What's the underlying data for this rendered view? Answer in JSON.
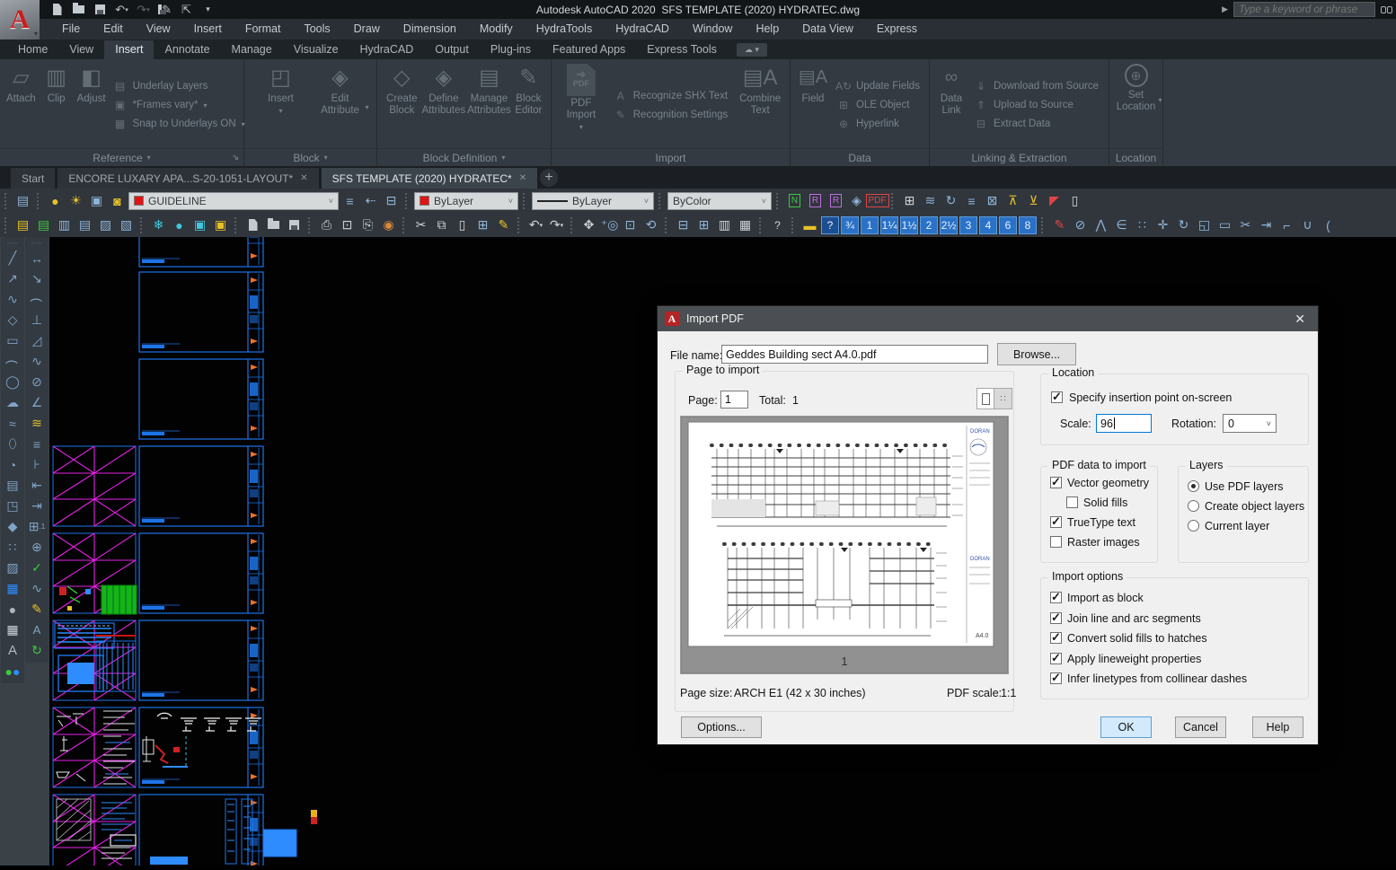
{
  "titlebar": {
    "app_title": "Autodesk AutoCAD 2020",
    "doc_title": "SFS TEMPLATE (2020) HYDRATEC.dwg",
    "search_placeholder": "Type a keyword or phrase"
  },
  "menubar": {
    "items": [
      "File",
      "Edit",
      "View",
      "Insert",
      "Format",
      "Tools",
      "Draw",
      "Dimension",
      "Modify",
      "HydraTools",
      "HydraCAD",
      "Window",
      "Help",
      "Data View",
      "Express"
    ]
  },
  "ribbon": {
    "tabs": [
      "Home",
      "View",
      "Insert",
      "Annotate",
      "Manage",
      "Visualize",
      "HydraCAD",
      "Output",
      "Plug-ins",
      "Featured Apps",
      "Express Tools"
    ],
    "active_tab": "Insert",
    "panels": [
      {
        "label": "Reference",
        "big": [
          "Attach",
          "Clip",
          "Adjust"
        ],
        "rows": [
          "Underlay Layers",
          "*Frames vary*",
          "Snap to Underlays ON"
        ]
      },
      {
        "label": "Block",
        "big": [
          "Insert",
          "Edit Attribute"
        ]
      },
      {
        "label": "Block Definition",
        "big": [
          "Create Block",
          "Define Attributes",
          "Manage Attributes",
          "Block Editor"
        ]
      },
      {
        "label": "Import",
        "big": [
          "PDF Import",
          "Combine Text"
        ],
        "rows": [
          "Recognize SHX Text",
          "Recognition Settings"
        ]
      },
      {
        "label": "Data",
        "big": [
          "Field"
        ],
        "rows": [
          "Update Fields",
          "OLE Object",
          "Hyperlink"
        ]
      },
      {
        "label": "Linking & Extraction",
        "big": [
          "Data Link"
        ],
        "rows": [
          "Download from Source",
          "Upload to Source",
          "Extract  Data"
        ]
      },
      {
        "label": "Location",
        "big": [
          "Set Location"
        ]
      }
    ]
  },
  "file_tabs": {
    "tabs": [
      "Start",
      "ENCORE LUXARY APA...S-20-1051-LAYOUT*",
      "SFS TEMPLATE (2020) HYDRATEC*"
    ],
    "active": "SFS TEMPLATE (2020) HYDRATEC*",
    "close_glyph": "✕",
    "new_tab_glyph": "+"
  },
  "toolbars": {
    "layer_value": "GUIDELINE",
    "color_value": "ByLayer",
    "linetype_value": "ByLayer",
    "plotstyle_value": "ByColor",
    "scale_buttons": [
      "?",
      "¾",
      "1",
      "1¼",
      "1½",
      "2",
      "2½",
      "3",
      "4",
      "6",
      "8"
    ]
  },
  "dialog": {
    "title": "Import PDF",
    "close_glyph": "✕",
    "file_name_label": "File name:",
    "file_name_value": "Geddes Building sect A4.0.pdf",
    "browse_label": "Browse...",
    "page_group": {
      "label": "Page to import",
      "page_label": "Page:",
      "page_value": "1",
      "total_label": "Total:",
      "total_value": "1",
      "preview_page_number": "1",
      "preview_brand": "DORAN",
      "preview_sheet_no": "A4.0"
    },
    "page_size_label": "Page size:",
    "page_size_value": "ARCH E1 (42 x 30 inches)",
    "pdf_scale_label": "PDF scale:",
    "pdf_scale_value": "1:1",
    "location_group": {
      "label": "Location",
      "insertion_label": "Specify insertion point on-screen",
      "insertion_checked": true,
      "scale_label": "Scale:",
      "scale_value": "96",
      "rotation_label": "Rotation:",
      "rotation_value": "0"
    },
    "pdf_data_group": {
      "label": "PDF data to import",
      "items": [
        {
          "label": "Vector geometry",
          "checked": true
        },
        {
          "label": "Solid fills",
          "checked": false
        },
        {
          "label": "TrueType text",
          "checked": true
        },
        {
          "label": "Raster images",
          "checked": false
        }
      ]
    },
    "layers_group": {
      "label": "Layers",
      "options": [
        {
          "label": "Use PDF layers",
          "selected": true
        },
        {
          "label": "Create object layers",
          "selected": false
        },
        {
          "label": "Current layer",
          "selected": false
        }
      ]
    },
    "options_group": {
      "label": "Import options",
      "items": [
        "Import as block",
        "Join line and arc segments",
        "Convert solid fills to hatches",
        "Apply lineweight properties",
        "Infer linetypes from collinear dashes"
      ]
    },
    "buttons": {
      "options": "Options...",
      "ok": "OK",
      "cancel": "Cancel",
      "help": "Help"
    }
  }
}
